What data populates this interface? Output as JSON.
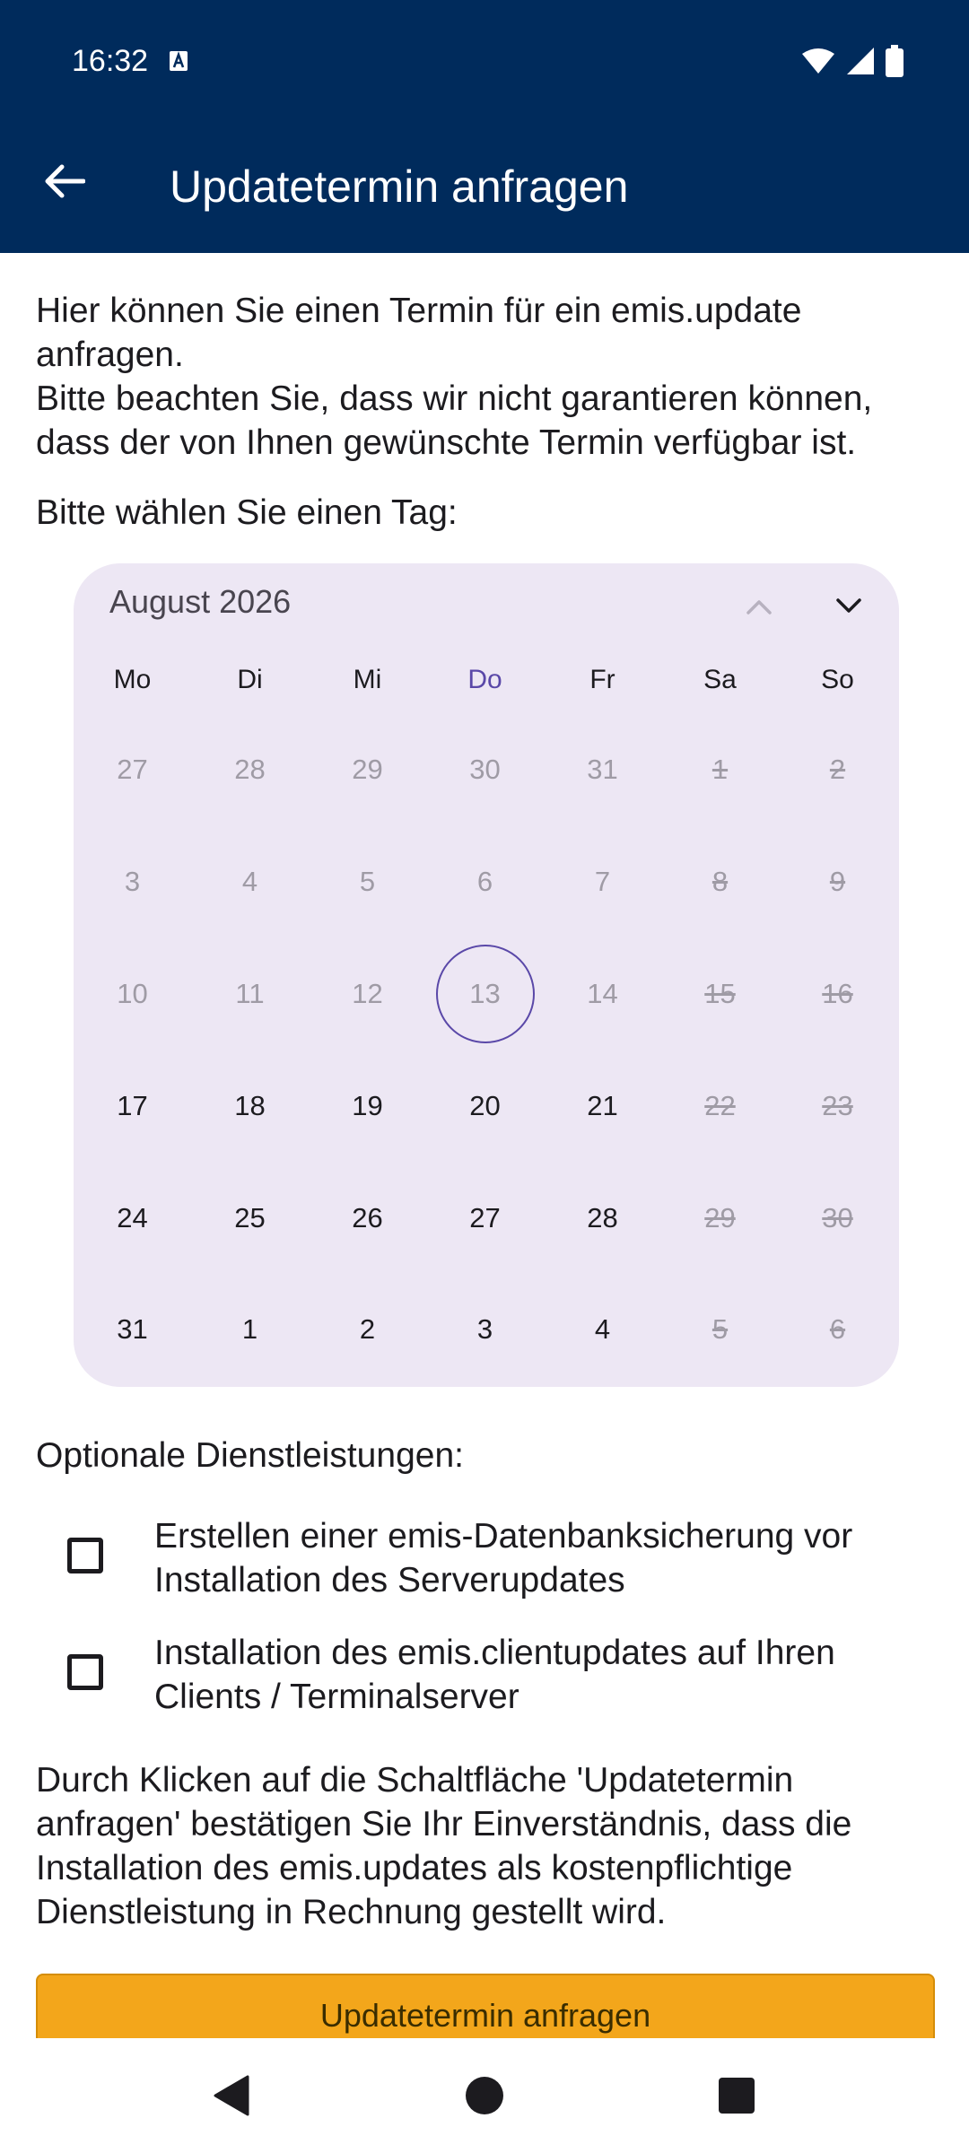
{
  "status_bar": {
    "time": "16:32",
    "icons": [
      "keyboard-a-icon",
      "wifi-icon",
      "cell-signal-icon",
      "battery-icon"
    ]
  },
  "header": {
    "title": "Updatetermin anfragen",
    "back_icon": "arrow-left-icon",
    "background": "#002b5c"
  },
  "intro": {
    "line1": "Hier können Sie einen Termin für ein emis.update anfragen.",
    "line2": "Bitte beachten Sie, dass wir nicht garantieren können, dass der von Ihnen gewünschte Termin verfügbar ist."
  },
  "day_prompt": "Bitte wählen Sie einen Tag:",
  "calendar": {
    "month_label": "August 2026",
    "prev_icon": "chevron-up-icon",
    "next_icon": "chevron-down-icon",
    "weekdays": [
      "Mo",
      "Di",
      "Mi",
      "Do",
      "Fr",
      "Sa",
      "So"
    ],
    "today_weekday_index": 3,
    "background": "#ede7f4",
    "accent": "#5a48a8",
    "days": [
      {
        "label": "27",
        "state": "muted"
      },
      {
        "label": "28",
        "state": "muted"
      },
      {
        "label": "29",
        "state": "muted"
      },
      {
        "label": "30",
        "state": "muted"
      },
      {
        "label": "31",
        "state": "muted"
      },
      {
        "label": "1",
        "state": "strike"
      },
      {
        "label": "2",
        "state": "strike"
      },
      {
        "label": "3",
        "state": "muted"
      },
      {
        "label": "4",
        "state": "muted"
      },
      {
        "label": "5",
        "state": "muted"
      },
      {
        "label": "6",
        "state": "muted"
      },
      {
        "label": "7",
        "state": "muted"
      },
      {
        "label": "8",
        "state": "strike"
      },
      {
        "label": "9",
        "state": "strike"
      },
      {
        "label": "10",
        "state": "muted"
      },
      {
        "label": "11",
        "state": "muted"
      },
      {
        "label": "12",
        "state": "muted"
      },
      {
        "label": "13",
        "state": "today"
      },
      {
        "label": "14",
        "state": "muted"
      },
      {
        "label": "15",
        "state": "strike"
      },
      {
        "label": "16",
        "state": "strike"
      },
      {
        "label": "17",
        "state": "available"
      },
      {
        "label": "18",
        "state": "available"
      },
      {
        "label": "19",
        "state": "available"
      },
      {
        "label": "20",
        "state": "available"
      },
      {
        "label": "21",
        "state": "available"
      },
      {
        "label": "22",
        "state": "strike"
      },
      {
        "label": "23",
        "state": "strike"
      },
      {
        "label": "24",
        "state": "available"
      },
      {
        "label": "25",
        "state": "available"
      },
      {
        "label": "26",
        "state": "available"
      },
      {
        "label": "27",
        "state": "available"
      },
      {
        "label": "28",
        "state": "available"
      },
      {
        "label": "29",
        "state": "strike"
      },
      {
        "label": "30",
        "state": "strike"
      },
      {
        "label": "31",
        "state": "available"
      },
      {
        "label": "1",
        "state": "available"
      },
      {
        "label": "2",
        "state": "available"
      },
      {
        "label": "3",
        "state": "available"
      },
      {
        "label": "4",
        "state": "available"
      },
      {
        "label": "5",
        "state": "strike"
      },
      {
        "label": "6",
        "state": "strike"
      }
    ]
  },
  "options": {
    "title": "Optionale Dienstleistungen:",
    "items": [
      {
        "label": "Erstellen einer emis-Datenbanksicherung vor Installation des Serverupdates",
        "checked": false
      },
      {
        "label": "Installation des emis.clientupdates auf Ihren Clients / Terminalserver",
        "checked": false
      }
    ]
  },
  "disclaimer": "Durch Klicken auf die Schaltfläche 'Updatetermin anfragen' bestätigen Sie Ihr Einverständnis, dass die Installation des emis.updates als kostenpflichtige Dienstleistung in Rechnung gestellt wird.",
  "submit": {
    "label": "Updatetermin anfragen",
    "color": "#f3a61b"
  },
  "nav_bar": {
    "icons": [
      "nav-back-icon",
      "nav-home-icon",
      "nav-recents-icon"
    ]
  }
}
